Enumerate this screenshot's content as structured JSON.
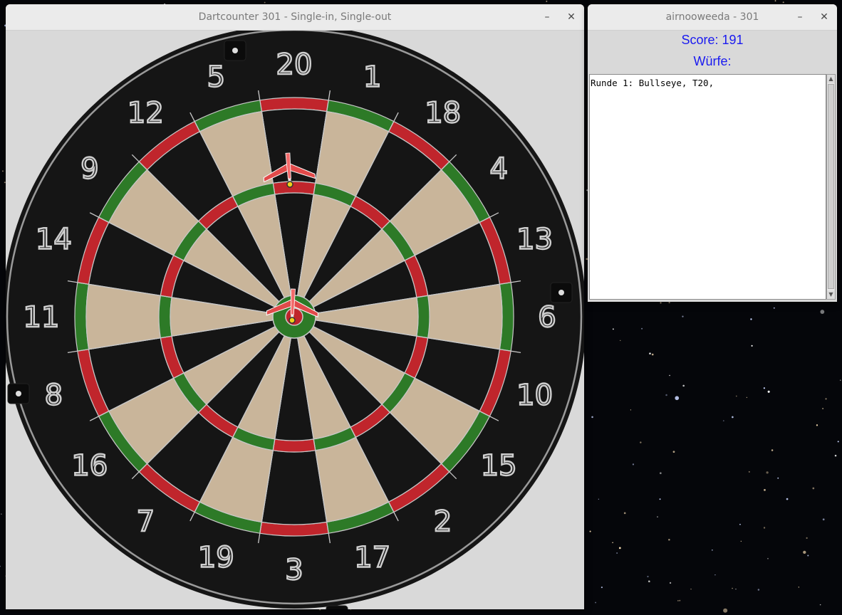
{
  "desktop": {
    "background": "starfield"
  },
  "main_window": {
    "title": "Dartcounter 301 - Single-in, Single-out",
    "minimize_icon": "–",
    "close_icon": "✕"
  },
  "dartboard": {
    "numbers": [
      "20",
      "1",
      "18",
      "4",
      "13",
      "6",
      "10",
      "15",
      "2",
      "17",
      "3",
      "19",
      "7",
      "16",
      "8",
      "11",
      "14",
      "9",
      "12",
      "5"
    ],
    "colors": {
      "red": "#c0252c",
      "green": "#2d7a27",
      "black": "#151515",
      "cream": "#c9b59a",
      "wire": "#c8c8c8"
    }
  },
  "side_window": {
    "title": "airnooweeda - 301",
    "minimize_icon": "–",
    "close_icon": "✕",
    "score_label": "Score: 191",
    "throws_label": "Würfe:",
    "log_text": "Runde 1: Bullseye, T20,",
    "scroll_up": "▲",
    "scroll_down": "▼"
  }
}
